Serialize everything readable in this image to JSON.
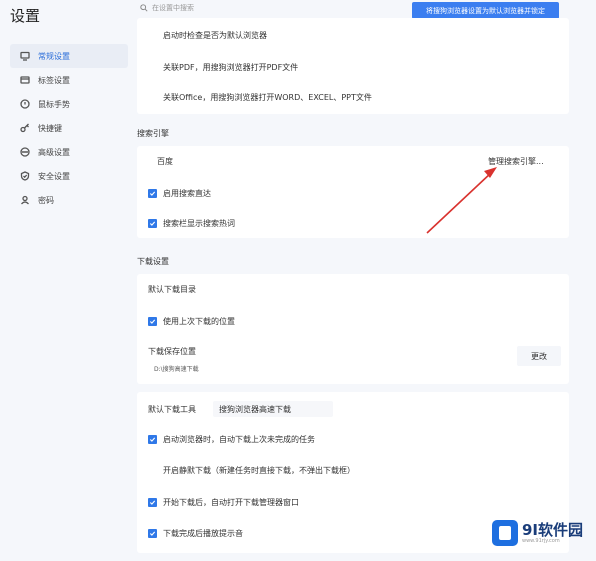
{
  "window": {
    "title": "设置"
  },
  "search": {
    "placeholder": "在设置中搜索"
  },
  "top_button": {
    "label": "将搜狗浏览器设置为默认浏览器并锁定"
  },
  "sidebar": {
    "items": [
      {
        "label": "常规设置",
        "icon": "monitor-icon"
      },
      {
        "label": "标签设置",
        "icon": "tab-icon"
      },
      {
        "label": "鼠标手势",
        "icon": "mouse-icon"
      },
      {
        "label": "快捷键",
        "icon": "key-icon"
      },
      {
        "label": "高级设置",
        "icon": "dots-icon"
      },
      {
        "label": "安全设置",
        "icon": "shield-icon"
      },
      {
        "label": "密码",
        "icon": "user-icon"
      }
    ]
  },
  "default_browser": {
    "items": [
      "启动时检查是否为默认浏览器",
      "关联PDF，用搜狗浏览器打开PDF文件",
      "关联Office，用搜狗浏览器打开WORD、EXCEL、PPT文件"
    ]
  },
  "search_engine": {
    "section_title": "搜索引擎",
    "engine": "百度",
    "manage_link": "管理搜索引擎...",
    "options": [
      "启用搜索直达",
      "搜索栏显示搜索热词"
    ]
  },
  "download": {
    "section_title": "下载设置",
    "default_dir_label": "默认下载目录",
    "use_last": "使用上次下载的位置",
    "save_location_label": "下载保存位置",
    "save_path": "D:\\搜狗高速下载",
    "change_button": "更改",
    "default_tool_label": "默认下载工具",
    "default_tool_value": "搜狗浏览器高速下载",
    "options": [
      {
        "label": "启动浏览器时，自动下载上次未完成的任务",
        "checked": true
      },
      {
        "label": "开启静默下载（新建任务时直接下载，不弹出下载框）",
        "checked": false
      },
      {
        "label": "开始下载后，自动打开下载管理器窗口",
        "checked": true
      },
      {
        "label": "下载完成后播放提示音",
        "checked": true
      }
    ]
  },
  "watermark": {
    "brand": "9I软件园",
    "sub": "www.91rjy.com"
  },
  "colors": {
    "accent": "#2f78e8",
    "arrow": "#d9322e",
    "background": "#f5f7fb"
  }
}
